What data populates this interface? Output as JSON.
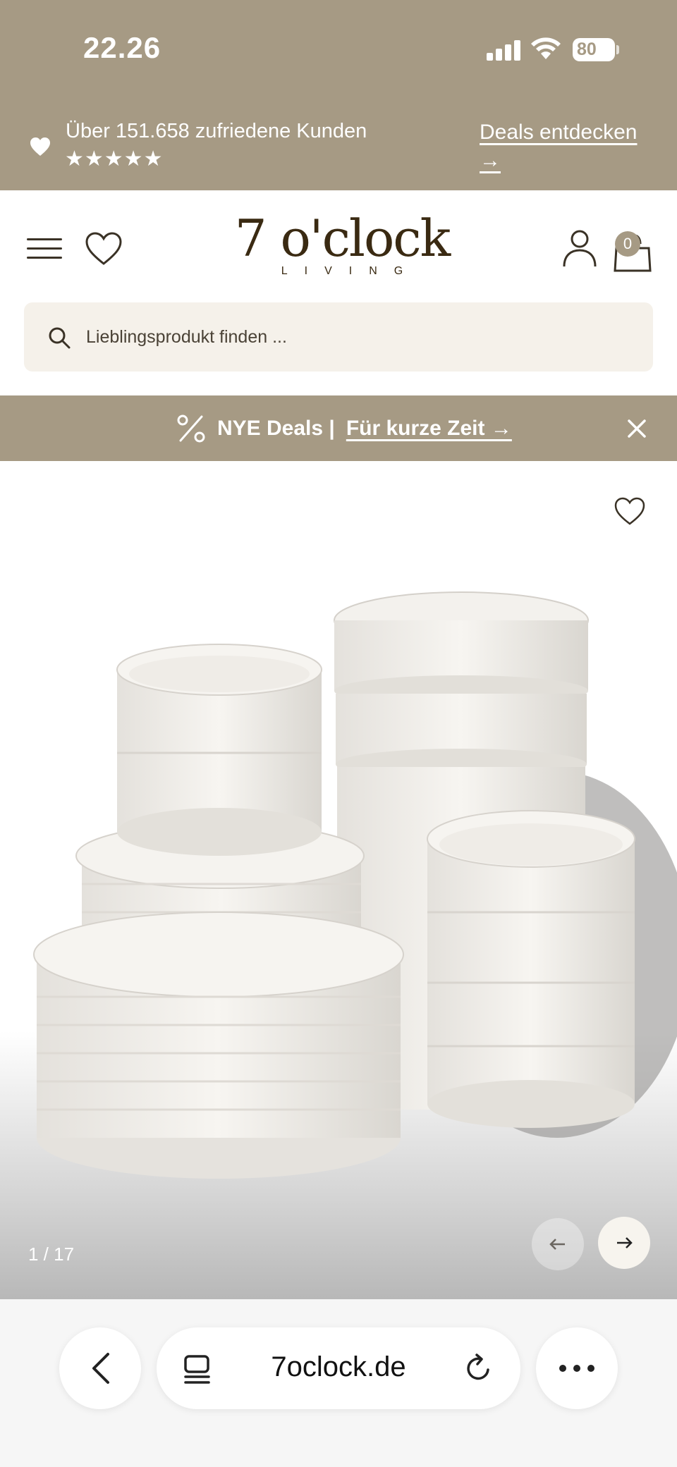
{
  "status_bar": {
    "time": "22.26",
    "battery": "80"
  },
  "promo": {
    "text": "Über 151.658 zufriedene Kunden",
    "stars": "★★★★★",
    "link_text": "Deals entdecken",
    "link_arrow": "→"
  },
  "header": {
    "logo_main": "7 o'clock",
    "logo_sub": "LIVING",
    "cart_count": "0"
  },
  "search": {
    "placeholder": "Lieblingsprodukt finden ..."
  },
  "deal_banner": {
    "label": "NYE Deals |",
    "link": "Für kurze Zeit →"
  },
  "gallery": {
    "counter": "1 / 17"
  },
  "browser": {
    "url": "7oclock.de"
  },
  "colors": {
    "brand_tan": "#a69a84",
    "search_bg": "#f5f1ea",
    "logo_brown": "#3a2a12"
  },
  "icons": [
    "heart-icon",
    "menu-icon",
    "wishlist-heart-icon",
    "account-icon",
    "cart-icon",
    "search-icon",
    "percent-icon",
    "close-icon",
    "arrow-left-icon",
    "arrow-right-icon",
    "back-chevron-icon",
    "tabs-icon",
    "reload-icon",
    "more-icon"
  ]
}
